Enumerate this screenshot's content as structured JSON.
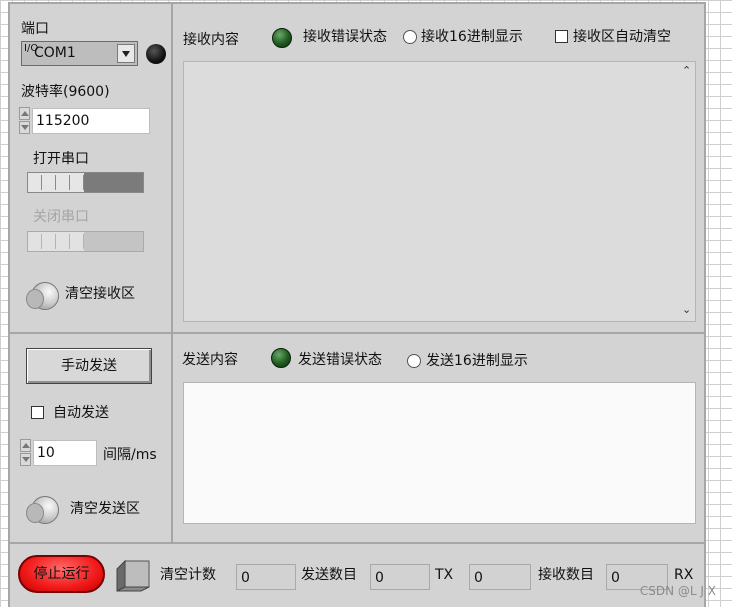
{
  "serial": {
    "port_label": "端口",
    "port_io": "I/O",
    "port_value": "COM1",
    "baud_label": "波特率(9600)",
    "baud_value": "115200",
    "open_label": "打开串口",
    "close_label": "关闭串口",
    "clear_rx_label": "清空接收区"
  },
  "receive": {
    "title": "接收内容",
    "error_label": "接收错误状态",
    "hex_label": "接收16进制显示",
    "autoclear_label": "接收区自动清空",
    "content": ""
  },
  "send_ctrl": {
    "manual_send_label": "手动发送",
    "auto_send_label": "自动发送",
    "interval_value": "10",
    "interval_label": "间隔/ms",
    "clear_tx_label": "清空发送区"
  },
  "send": {
    "title": "发送内容",
    "error_label": "发送错误状态",
    "hex_label": "发送16进制显示",
    "content": ""
  },
  "bottom": {
    "stop_label": "停止运行",
    "clear_count_label": "清空计数",
    "clear_count_value": "0",
    "send_count_label": "发送数目",
    "send_count_value": "0",
    "tx_label": "TX",
    "tx_value": "0",
    "recv_count_label": "接收数目",
    "recv_count_value": "0",
    "rx_label": "RX"
  },
  "watermark": "CSDN @L  J X"
}
